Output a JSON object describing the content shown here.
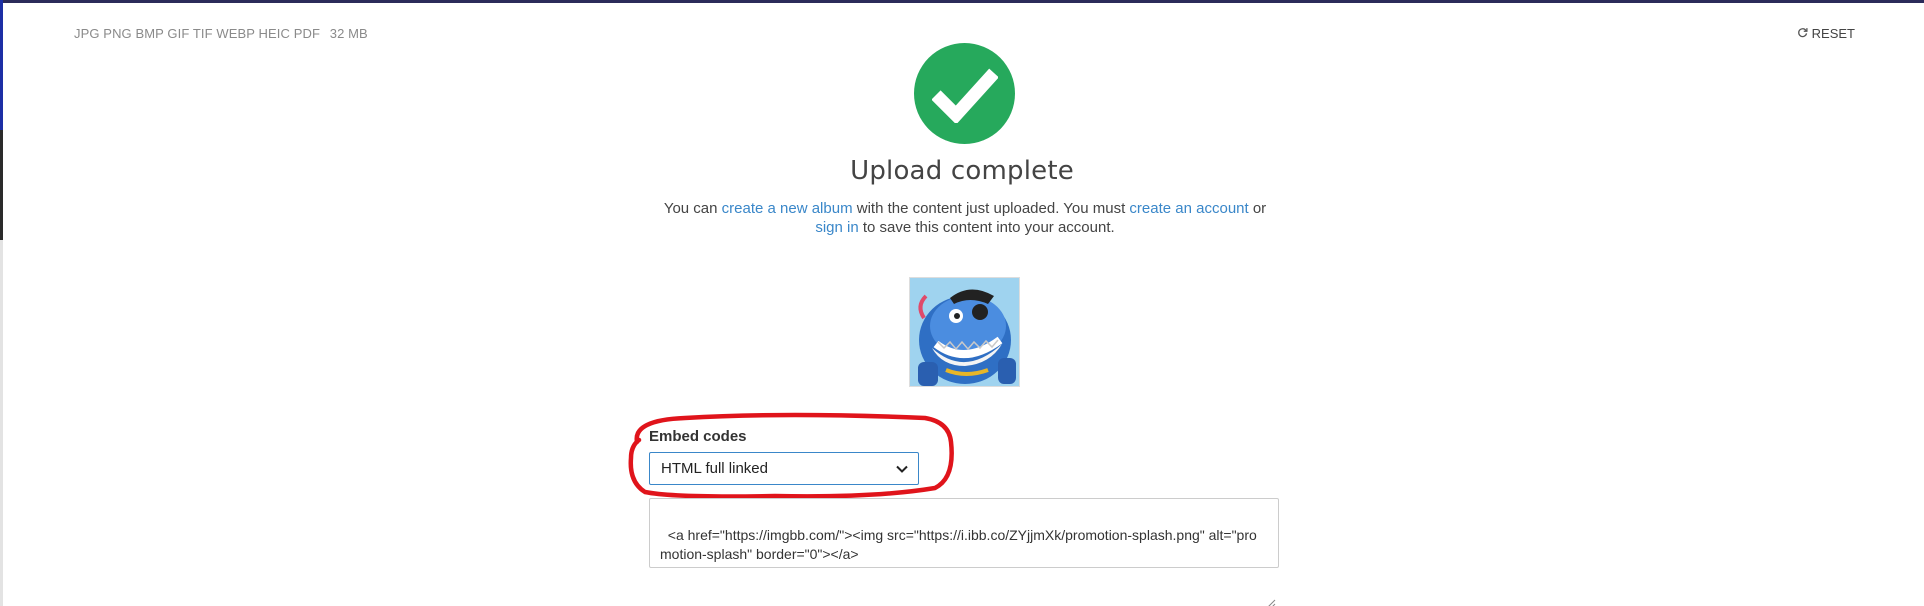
{
  "header": {
    "formats": "JPG PNG BMP GIF TIF WEBP HEIC PDF",
    "max_size": "32 MB",
    "reset_label": "RESET"
  },
  "status": {
    "title": "Upload complete",
    "icon": "check-icon",
    "color": "#26a95c"
  },
  "message": {
    "part1": "You can ",
    "link_album": "create a new album",
    "part2": " with the content just uploaded. You must ",
    "link_account": "create an account",
    "part3": " or ",
    "link_signin": "sign in",
    "part4": " to save this content into your account."
  },
  "embed": {
    "label": "Embed codes",
    "selected_option": "HTML full linked",
    "code": "<a href=\"https://imgbb.com/\"><img src=\"https://i.ibb.co/ZYjjmXk/promotion-splash.png\" alt=\"promotion-splash\" border=\"0\"></a>"
  },
  "colors": {
    "link": "#3a87c9",
    "annotation": "#e0141b"
  }
}
